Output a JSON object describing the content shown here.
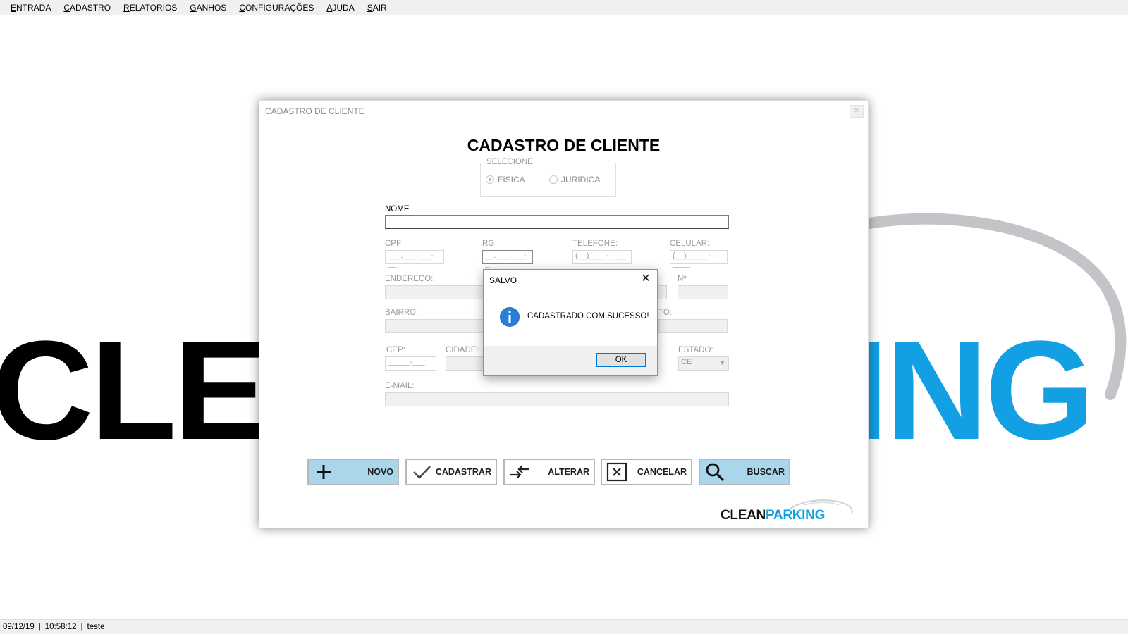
{
  "menu": [
    {
      "first": "E",
      "rest": "NTRADA"
    },
    {
      "first": "C",
      "rest": "ADASTRO"
    },
    {
      "first": "R",
      "rest": "ELATORIOS"
    },
    {
      "first": "G",
      "rest": "ANHOS"
    },
    {
      "first": "C",
      "rest": "ONFIGURAÇÕES"
    },
    {
      "first": "A",
      "rest": "JUDA"
    },
    {
      "first": "S",
      "rest": "AIR"
    }
  ],
  "background": {
    "left_word": "CLE",
    "right_word": "ING"
  },
  "form": {
    "window_title": "CADASTRO DE CLIENTE",
    "heading": "CADASTRO DE CLIENTE",
    "selecione": {
      "legend": "SELECIONE",
      "fisica": "FISICA",
      "juridica": "JURIDICA",
      "selected": "FISICA"
    },
    "labels": {
      "nome": "NOME",
      "cpf": "CPF",
      "rg": "RG",
      "telefone": "TELEFONE:",
      "celular": "CELULAR:",
      "endereco": "ENDEREÇO:",
      "numero": "Nº",
      "bairro": "BAIRRO:",
      "complemento_partial": "TO:",
      "cep": "CEP:",
      "cidade": "CIDADE:",
      "estado": "ESTADO:",
      "email": "E-MAIL:"
    },
    "values": {
      "nome": "",
      "cpf": "___.___.___-__",
      "rg": "__.___.___-_",
      "telefone": "(__)____-____",
      "celular": "(__)_____-____",
      "cep": "_____-___",
      "estado": "CE"
    },
    "buttons": {
      "novo": "NOVO",
      "cadastrar": "CADASTRAR",
      "alterar": "ALTERAR",
      "cancelar": "CANCELAR",
      "buscar": "BUSCAR"
    },
    "logo": {
      "part1": "CLEAN",
      "part2": "PARKING"
    }
  },
  "dialog": {
    "title": "SALVO",
    "close": "✕",
    "message": "CADASTRADO COM SUCESSO!",
    "ok": "OK"
  },
  "status": {
    "date": "09/12/19",
    "time": "10:58:12",
    "user": "teste"
  },
  "colors": {
    "brand_blue": "#139fe3",
    "button_blue": "#a9d6ea",
    "dialog_border": "#e07a45",
    "focus_blue": "#0078d7"
  }
}
